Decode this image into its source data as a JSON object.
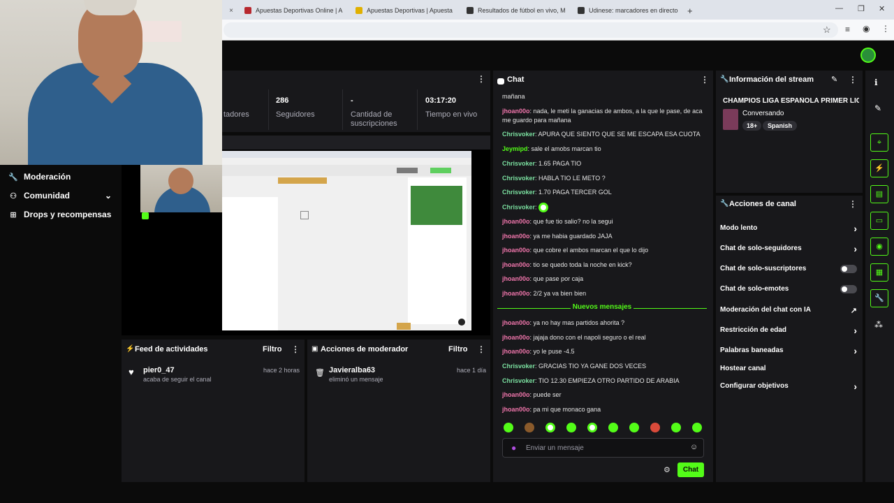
{
  "browser": {
    "tabs": [
      {
        "title": "Apuestas Deportivas Online | A",
        "color": "#b7282e"
      },
      {
        "title": "Apuestas Deportivas | Apuesta",
        "color": "#e0b000"
      },
      {
        "title": "Resultados de fútbol en vivo, M",
        "color": "#333333"
      },
      {
        "title": "Udinese: marcadores en directo",
        "color": "#333333"
      }
    ],
    "new_tab": "+",
    "close": "×",
    "window_controls": [
      "—",
      "❐",
      "✕"
    ]
  },
  "stats": {
    "followers_partial_label": "tadores",
    "followers_count": "286",
    "followers_label": "Seguidores",
    "subs_count": "-",
    "subs_label_1": "Cantidad de",
    "subs_label_2": "suscripciones",
    "live_time": "03:17:20",
    "live_label": "Tiempo en vivo"
  },
  "sidebar": {
    "items": [
      {
        "label": "Moderación",
        "icon": "wrench-icon"
      },
      {
        "label": "Comunidad",
        "icon": "users-icon"
      },
      {
        "label": "Drops y recompensas",
        "icon": "gift-icon"
      }
    ]
  },
  "activity_feed": {
    "title": "Feed de actividades",
    "filter": "Filtro",
    "items": [
      {
        "user": "pier0_47",
        "action": "acaba de seguir el canal",
        "time": "hace 2 horas"
      }
    ]
  },
  "mod_actions": {
    "title": "Acciones de moderador",
    "filter": "Filtro",
    "items": [
      {
        "user": "Javieralba63",
        "action": "eliminó un mensaje",
        "time": "hace 1 día"
      }
    ]
  },
  "chat": {
    "title": "Chat",
    "partial_top": "mañana",
    "messages": [
      {
        "user": "jhoan00o",
        "text": "nada, le meti la ganacias de ambos, a la que le pase, de aca me guardo para mañana",
        "color": "pink"
      },
      {
        "user": "Chrisvoker",
        "text": "APURA QUE SIENTO QUE SE ME ESCAPA ESA CUOTA",
        "color": "cyan"
      },
      {
        "user": "Jeymipd",
        "text": "sale el amobs marcan tio",
        "color": "green"
      },
      {
        "user": "Chrisvoker",
        "text": "1.65 PAGA TIO",
        "color": "cyan"
      },
      {
        "user": "Chrisvoker",
        "text": "HABLA TIO LE METO ?",
        "color": "cyan"
      },
      {
        "user": "Chrisvoker",
        "text": "1.70 PAGA TERCER GOL",
        "color": "cyan"
      },
      {
        "user": "Chrisvoker",
        "text": "",
        "color": "cyan"
      },
      {
        "user": "jhoan00o",
        "text": "que fue tio salio? no la segui",
        "color": "pink"
      },
      {
        "user": "jhoan00o",
        "text": "ya me habia guardado JAJA",
        "color": "pink"
      },
      {
        "user": "jhoan00o",
        "text": "que cobre el ambos marcan el que lo dijo",
        "color": "pink"
      },
      {
        "user": "jhoan00o",
        "text": "tio se quedo toda la noche en kick?",
        "color": "pink"
      },
      {
        "user": "jhoan00o",
        "text": "que pase por caja",
        "color": "pink"
      },
      {
        "user": "jhoan00o",
        "text": "2/2 ya va bien bien",
        "color": "pink"
      }
    ],
    "new_messages_label": "Nuevos mensajes",
    "new_messages": [
      {
        "user": "jhoan00o",
        "text": "ya no hay mas partidos ahorita ?",
        "color": "pink"
      },
      {
        "user": "jhoan00o",
        "text": "jajaja dono con el napoli seguro o el real",
        "color": "pink"
      },
      {
        "user": "jhoan00o",
        "text": "yo le puse -4.5",
        "color": "pink"
      },
      {
        "user": "Chrisvoker",
        "text": "GRACIAS TIO YA GANE DOS VECES",
        "color": "cyan"
      },
      {
        "user": "Chrisvoker",
        "text": "TIO 12.30 EMPIEZA OTRO PARTIDO DE ARABIA",
        "color": "cyan"
      },
      {
        "user": "jhoan00o",
        "text": "puede ser",
        "color": "pink"
      },
      {
        "user": "jhoan00o",
        "text": "pa mi que monaco gana",
        "color": "pink"
      }
    ],
    "input_placeholder": "Enviar un mensaje",
    "send_label": "Chat"
  },
  "stream_info": {
    "title": "Información del stream",
    "stream_title": "CHAMPIOS LIGA ESPAÑOLA PRIMER LIGE",
    "category": "Conversando",
    "tags": [
      "18+",
      "Spanish"
    ]
  },
  "channel_actions": {
    "title": "Acciones de canal",
    "items": [
      {
        "label": "Modo lento",
        "kind": "chevron"
      },
      {
        "label": "Chat de solo-seguidores",
        "kind": "chevron"
      },
      {
        "label": "Chat de solo-suscriptores",
        "kind": "toggle"
      },
      {
        "label": "Chat de solo-emotes",
        "kind": "toggle"
      },
      {
        "label": "Moderación del chat con IA",
        "kind": "external"
      },
      {
        "label": "Restricción de edad",
        "kind": "chevron"
      },
      {
        "label": "Palabras baneadas",
        "kind": "chevron"
      },
      {
        "label": "Hostear canal",
        "kind": "none"
      },
      {
        "label": "Configurar objetivos",
        "kind": "chevron"
      }
    ]
  },
  "colors": {
    "accent": "#53fc18",
    "panel": "#18181b",
    "background": "#0b0b0b"
  }
}
